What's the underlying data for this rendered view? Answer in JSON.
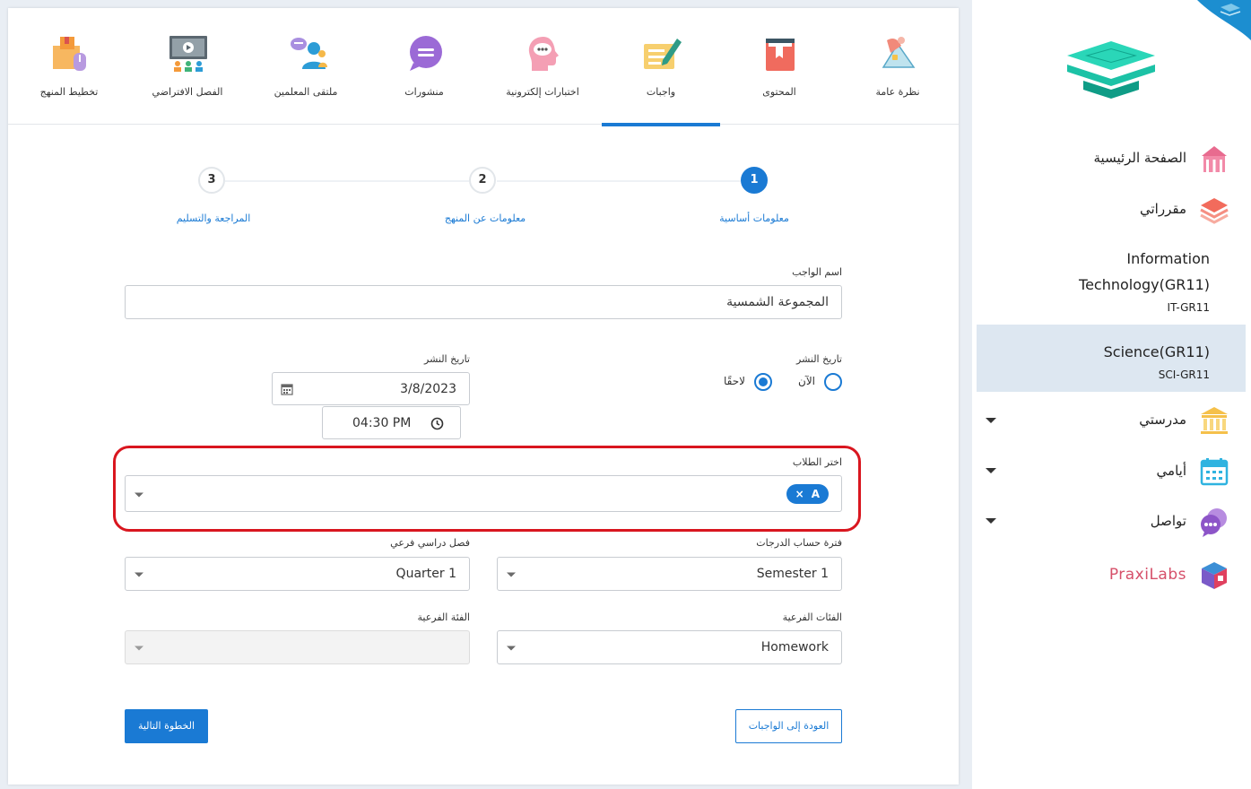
{
  "tabs": [
    {
      "label": "نظرة عامة",
      "icon": "overview-lamp-icon"
    },
    {
      "label": "المحتوى",
      "icon": "content-book-icon"
    },
    {
      "label": "واجبات",
      "icon": "assignments-icon"
    },
    {
      "label": "اختبارات إلكترونية",
      "icon": "quiz-head-icon"
    },
    {
      "label": "منشورات",
      "icon": "posts-chat-icon"
    },
    {
      "label": "ملتقى المعلمين",
      "icon": "teachers-forum-icon"
    },
    {
      "label": "الفصل الافتراضي",
      "icon": "virtual-class-icon"
    },
    {
      "label": "تخطيط المنهج",
      "icon": "curriculum-plan-icon"
    }
  ],
  "active_tab": "واجبات",
  "steps": [
    {
      "num": "1",
      "label": "معلومات أساسية"
    },
    {
      "num": "2",
      "label": "معلومات عن المنهج"
    },
    {
      "num": "3",
      "label": "المراجعة والتسليم"
    }
  ],
  "form": {
    "name_label": "اسم الواجب",
    "name_value": "المجموعة الشمسية",
    "publish_label": "تاريخ النشر",
    "radio_now": "الآن",
    "radio_later": "لاحقًا",
    "publish_date_label": "تاريخ النشر",
    "date_value": "3/8/2023",
    "time_value": "04:30 PM",
    "students_label": "اختر الطلاب",
    "student_chip": "A",
    "student_chip_remove": "×",
    "grading_period_label": "فترة حساب الدرجات",
    "grading_period_value": "Semester 1",
    "sub_term_label": "فصل دراسي فرعي",
    "sub_term_value": "Quarter 1",
    "subcategories_label": "الفئات الفرعية",
    "subcategories_value": "Homework",
    "subcategory_label": "الفئة الفرعية",
    "subcategory_value": ""
  },
  "buttons": {
    "next": "الخطوة التالية",
    "back": "العودة إلى الواجبات"
  },
  "sidebar": {
    "home": "الصفحة الرئيسية",
    "courses": "مقرراتي",
    "course_list": [
      {
        "name1": "Information",
        "name2": "Technology(GR11)",
        "code": "IT-GR11"
      },
      {
        "name1": "Science(GR11)",
        "name2": "",
        "code": "SCI-GR11"
      }
    ],
    "school": "مدرستي",
    "days": "أيامي",
    "communicate": "تواصل",
    "praxilabs": "PraxiLabs"
  },
  "colors": {
    "accent": "#1a7ad4",
    "highlight": "#d9161f",
    "selected_course_bg": "#dde7f1"
  }
}
